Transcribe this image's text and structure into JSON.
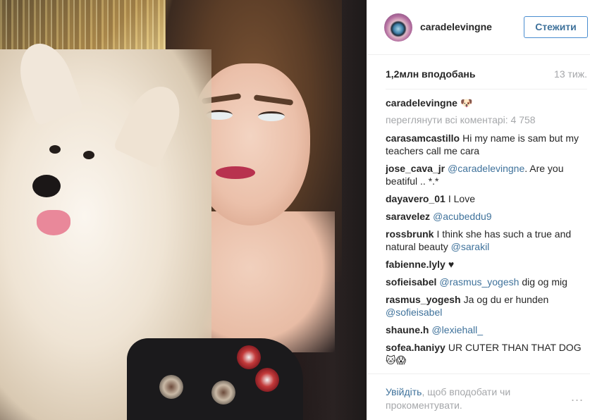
{
  "post": {
    "username": "caradelevingne",
    "follow_label": "Стежити",
    "likes": "1,2млн вподобань",
    "age": "13 тиж.",
    "caption_emoji": "🐶",
    "view_all_comments": "переглянути всі коментарі: 4 758"
  },
  "comments": [
    {
      "user": "carasamcastillo",
      "text": "Hi my name is sam but my teachers call me cara",
      "mention": ""
    },
    {
      "user": "jose_cava_jr",
      "mention": "@caradelevingne",
      "text": ". Are you beatiful .. *.*"
    },
    {
      "user": "dayavero_01",
      "text": "I Love",
      "mention": ""
    },
    {
      "user": "saravelez",
      "mention": "@acubeddu9",
      "text": ""
    },
    {
      "user": "rossbrunk",
      "text": "I think she has such a true and natural beauty",
      "mention": "@sarakil"
    },
    {
      "user": "fabienne.lyly",
      "text": "♥",
      "mention": ""
    },
    {
      "user": "sofieisabel",
      "mention": "@rasmus_yogesh",
      "text": "dig og mig"
    },
    {
      "user": "rasmus_yogesh",
      "text": "Ja og du er hunden",
      "mention": "@sofieisabel"
    },
    {
      "user": "shaune.h",
      "mention": "@lexiehall_",
      "text": ""
    },
    {
      "user": "sofea.haniyy",
      "text": "UR CUTER THAN THAT DOG 🐱😱",
      "mention": ""
    }
  ],
  "footer": {
    "login_link": "Увійдіть",
    "login_rest": ", щоб вподобати чи прокоментувати.",
    "more_icon": "..."
  },
  "colors": {
    "link": "#3f729b",
    "muted": "#a5a7aa",
    "text": "#262626"
  }
}
